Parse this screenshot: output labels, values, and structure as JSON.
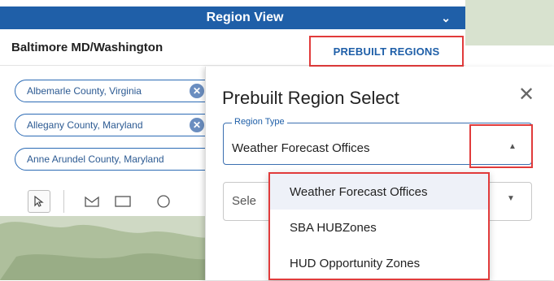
{
  "header": {
    "title": "Region View"
  },
  "subbar": {
    "region_name": "Baltimore MD/Washington",
    "prebuilt_label": "PREBUILT REGIONS"
  },
  "chips": [
    {
      "label": "Albemarle County, Virginia"
    },
    {
      "label": "Allegany County, Maryland"
    },
    {
      "label": "Anne Arundel County, Maryland"
    }
  ],
  "modal": {
    "title": "Prebuilt Region Select",
    "region_type_label": "Region Type",
    "region_type_value": "Weather Forecast Offices",
    "second_select_placeholder": "Sele"
  },
  "dropdown": {
    "options": [
      {
        "label": "Weather Forecast Offices"
      },
      {
        "label": "SBA HUBZones"
      },
      {
        "label": "HUD Opportunity Zones"
      }
    ]
  },
  "colors": {
    "header": "#1f5fa8",
    "highlight": "#e13b3b",
    "accent": "#2c6bb5"
  }
}
